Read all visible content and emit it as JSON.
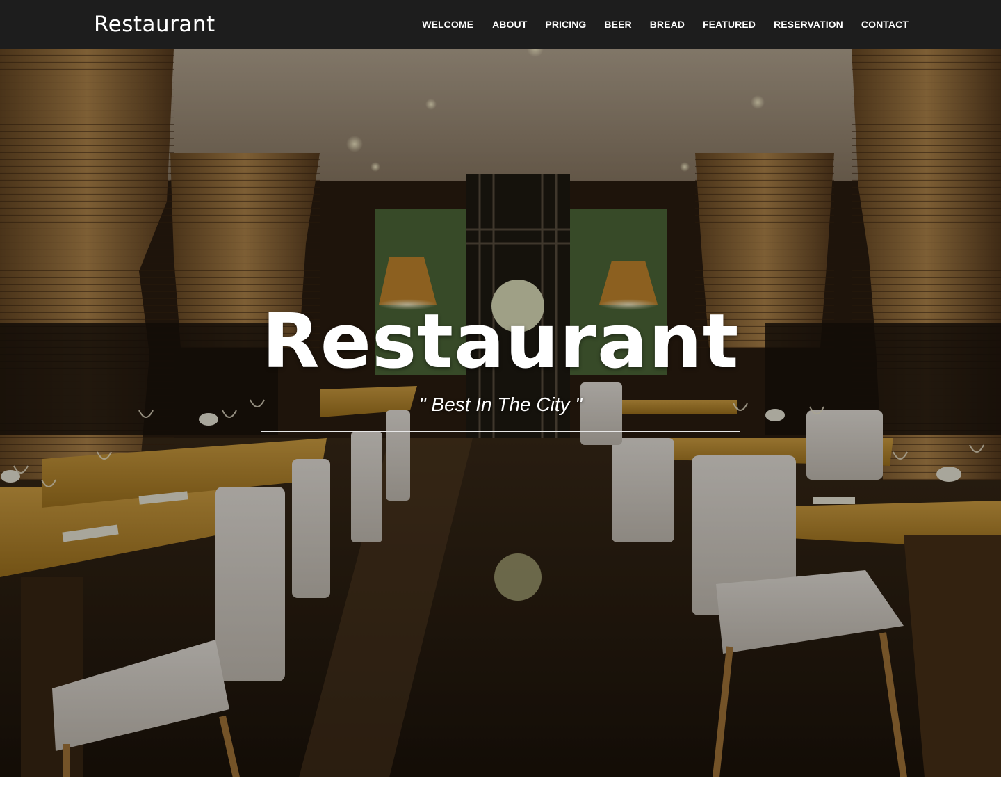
{
  "navbar": {
    "brand": "Restaurant",
    "items": [
      {
        "label": "WELCOME",
        "active": true
      },
      {
        "label": "ABOUT",
        "active": false
      },
      {
        "label": "PRICING",
        "active": false
      },
      {
        "label": "BEER",
        "active": false
      },
      {
        "label": "BREAD",
        "active": false
      },
      {
        "label": "FEATURED",
        "active": false
      },
      {
        "label": "RESERVATION",
        "active": false
      },
      {
        "label": "CONTACT",
        "active": false
      }
    ],
    "active_underline_color": "#6fbf5e",
    "background_color": "#1d1d1d"
  },
  "hero": {
    "title": "Restaurant",
    "tagline": "\" Best In The City \"",
    "background_image": "restaurant-interior-photo"
  }
}
